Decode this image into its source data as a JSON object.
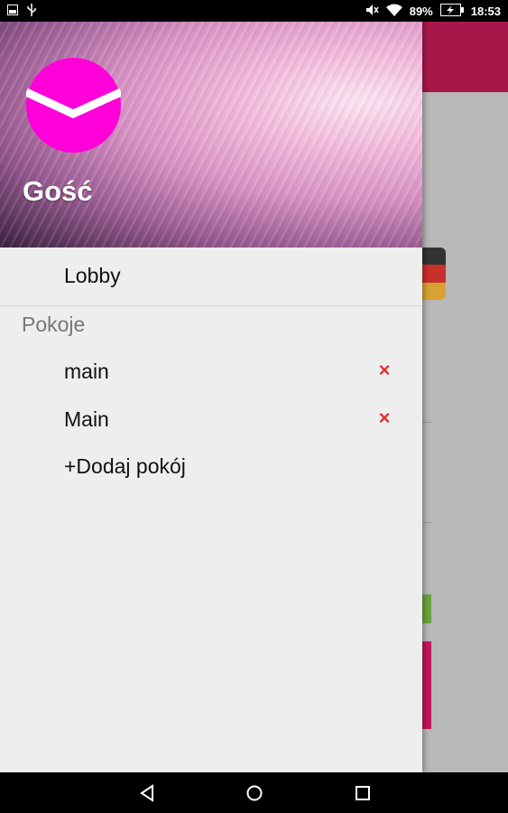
{
  "status_bar": {
    "battery": "89%",
    "time": "18:53"
  },
  "drawer": {
    "username": "Gość",
    "lobby_label": "Lobby",
    "rooms_section_title": "Pokoje",
    "rooms": [
      {
        "name": "main",
        "remove_icon": "×"
      },
      {
        "name": "Main",
        "remove_icon": "×"
      }
    ],
    "add_room_label": "+Dodaj pokój"
  },
  "colors": {
    "logo": "#ff00d9",
    "app_toolbar": "#a8174a",
    "remove_icon": "#e53030"
  },
  "icons": {
    "status_left": [
      "screenshot-icon",
      "usb-icon"
    ],
    "status_right": [
      "mute-icon",
      "wifi-icon",
      "battery-charging-icon"
    ],
    "nav": [
      "back-icon",
      "home-icon",
      "recents-icon"
    ]
  }
}
